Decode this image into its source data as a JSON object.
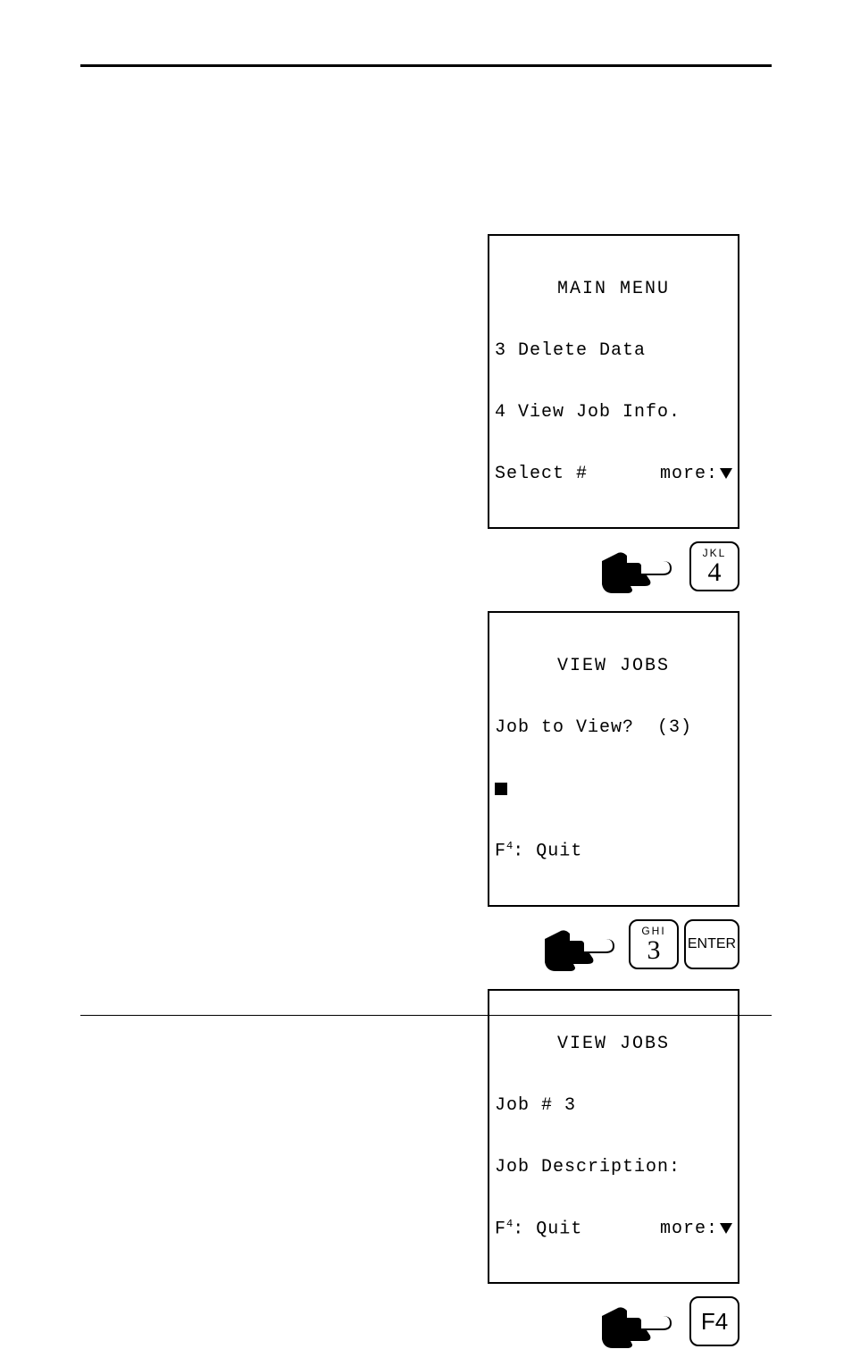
{
  "screen1": {
    "title": "MAIN MENU",
    "line1": "3 Delete Data",
    "line2": "4 View Job Info.",
    "prompt_left": "Select #",
    "prompt_right": "more:"
  },
  "key4": {
    "secondary": "JKL",
    "primary": "4"
  },
  "screen2": {
    "title": "VIEW JOBS",
    "line1": "Job to View?  (3)",
    "quit_prefix": "F",
    "quit_sub": "4",
    "quit_label": ": Quit"
  },
  "key3": {
    "secondary": "GHI",
    "primary": "3"
  },
  "keyEnter": {
    "label": "ENTER"
  },
  "screen3": {
    "title": "VIEW JOBS",
    "line1": "Job # 3",
    "line2": "Job Description:",
    "quit_prefix": "F",
    "quit_sub": "4",
    "quit_label": ": Quit",
    "more": "more:"
  },
  "keyF4": {
    "label": "F4"
  }
}
